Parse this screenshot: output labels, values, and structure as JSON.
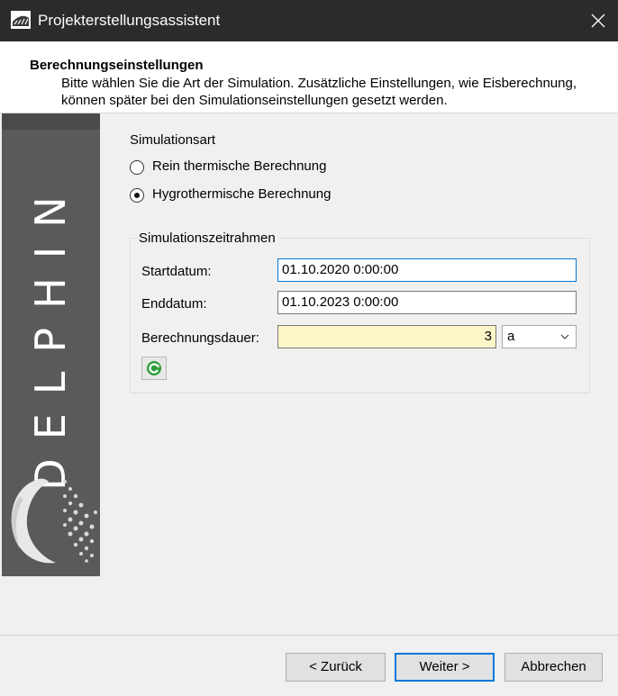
{
  "window": {
    "title": "Projekterstellungsassistent",
    "close_icon": "close-icon"
  },
  "header": {
    "title": "Berechnungseinstellungen",
    "description": "Bitte wählen Sie die Art der Simulation. Zusätzliche Einstellungen, wie Eisberechnung, können später bei den Simulationseinstellungen gesetzt werden."
  },
  "sidebar": {
    "brand": "DELPHIN"
  },
  "simulation_type": {
    "label": "Simulationsart",
    "options": [
      {
        "label": "Rein thermische Berechnung",
        "selected": false
      },
      {
        "label": "Hygrothermische Berechnung",
        "selected": true
      }
    ]
  },
  "timeframe": {
    "legend": "Simulationszeitrahmen",
    "start_label": "Startdatum:",
    "start_value": "01.10.2020  0:00:00",
    "end_label": "Enddatum:",
    "end_value": "01.10.2023  0:00:00",
    "duration_label": "Berechnungsdauer:",
    "duration_value": "3",
    "duration_unit": "a"
  },
  "buttons": {
    "back": "< Zurück",
    "next": "Weiter >",
    "cancel": "Abbrechen"
  },
  "colors": {
    "accent": "#0078d7",
    "duration_bg": "#fcf6c8",
    "titlebar": "#2b2b2b",
    "sidebar": "#5a5a5a"
  }
}
